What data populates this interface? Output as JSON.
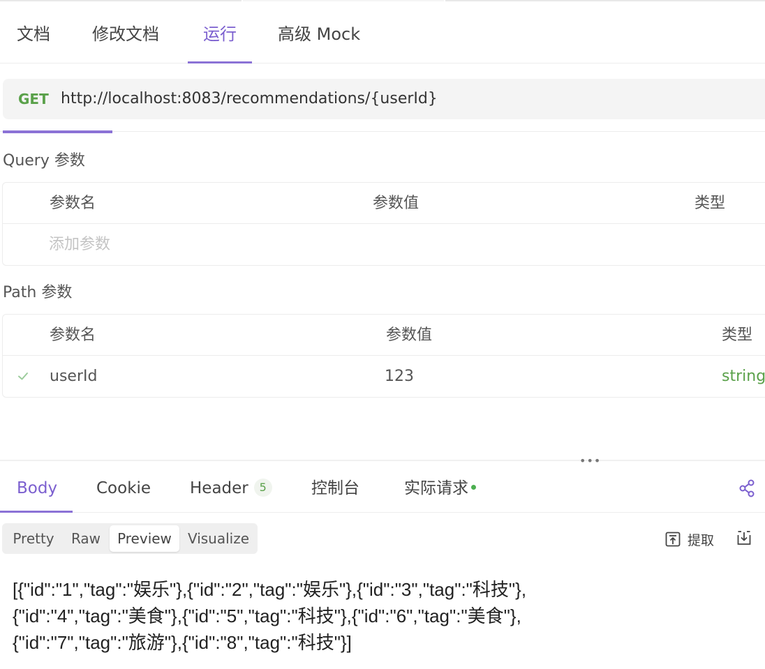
{
  "tabs": {
    "doc": "文档",
    "edit_doc": "修改文档",
    "run": "运行",
    "advanced_mock": "高级 Mock",
    "active": "运行"
  },
  "request": {
    "method": "GET",
    "url": "http://localhost:8083/recommendations/{userId}"
  },
  "query_params": {
    "title": "Query 参数",
    "headers": [
      "参数名",
      "参数值",
      "类型"
    ],
    "add_placeholder": "添加参数"
  },
  "path_params": {
    "title": "Path 参数",
    "headers": [
      "参数名",
      "参数值",
      "类型"
    ],
    "rows": [
      {
        "enabled": true,
        "name": "userId",
        "value": "123",
        "type": "string"
      }
    ]
  },
  "response": {
    "tabs": {
      "body": "Body",
      "cookie": "Cookie",
      "header": "Header",
      "header_count": "5",
      "console": "控制台",
      "actual_request": "实际请求",
      "active": "Body"
    },
    "view_modes": [
      "Pretty",
      "Raw",
      "Preview",
      "Visualize"
    ],
    "active_view_mode": "Preview",
    "extract_label": "提取",
    "body_lines": [
      "[{\"id\":\"1\",\"tag\":\"娱乐\"},{\"id\":\"2\",\"tag\":\"娱乐\"},{\"id\":\"3\",\"tag\":\"科技\"},",
      "{\"id\":\"4\",\"tag\":\"美食\"},{\"id\":\"5\",\"tag\":\"科技\"},{\"id\":\"6\",\"tag\":\"美食\"},",
      "{\"id\":\"7\",\"tag\":\"旅游\"},{\"id\":\"8\",\"tag\":\"科技\"}]"
    ]
  },
  "colors": {
    "accent": "#8b72d6",
    "method_get": "#5aa14a",
    "type_string": "#5aa14a",
    "status_dot": "#4caf50"
  },
  "icons": [
    "check-icon",
    "share-icon",
    "extract-icon",
    "download-icon",
    "resize-handle-icon"
  ]
}
